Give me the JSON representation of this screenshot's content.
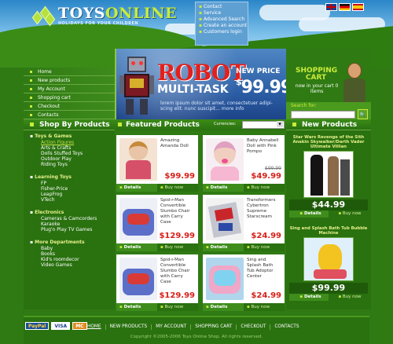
{
  "header": {
    "logo_main": "TOYS",
    "logo_accent": "ONLINE",
    "tagline": "HOLIDAYS FOR YOUR CHILDREN",
    "top_links": [
      "Contact",
      "Service",
      "Advanced Search",
      "Create an account",
      "Customers login"
    ],
    "flags": [
      "flag-uk",
      "flag-germany",
      "flag-spain"
    ]
  },
  "leftnav": [
    "Home",
    "New products",
    "My Account",
    "Shopping cart",
    "Checkout",
    "Contacts"
  ],
  "banner": {
    "headline": "ROBOT",
    "subheadline": "MULTI-TASK",
    "price_label": "NEW PRICE",
    "price_currency": "$",
    "price_value": "99.99",
    "description": "lorem ipsum dolor sit amet, consectetuer adipi-scing elit. nunc suscipit... more info"
  },
  "cart": {
    "title_line1": "SHOPPING",
    "title_line2": "CART",
    "info": "now in your cart 0 items"
  },
  "search": {
    "label": "Search for:",
    "placeholder": "",
    "button": "🔍"
  },
  "shop_by_products": {
    "title": "Shop By Products",
    "groups": [
      {
        "title": "Toys & Games",
        "links": [
          "Action Figures",
          "Arts & Crafts",
          "Dolls Stuffed Toys",
          "Outdoor Play",
          "Riding Toys"
        ],
        "active_index": 0
      },
      {
        "title": "Learning Toys",
        "links": [
          "FP",
          "Fisher-Price",
          "LeapFrog",
          "VTech"
        ],
        "active_index": -1
      },
      {
        "title": "Electronics",
        "links": [
          "Cameras & Camcorders",
          "Karaoke",
          "Plug'n Play TV Games"
        ],
        "active_index": -1
      },
      {
        "title": "More Departments",
        "links": [
          "Baby",
          "Books",
          "Kid's roomdecor",
          "Video Games"
        ],
        "active_index": -1
      }
    ]
  },
  "featured": {
    "title": "Featured Products",
    "currencies_label": "Currencies:",
    "currency_selected": "",
    "details_label": "Details",
    "buy_label": "Buy now",
    "products": [
      {
        "name": "Amazing Amanda Doll",
        "price": "$99.99",
        "old_price": "",
        "img_color": "#e9c4a6"
      },
      {
        "name": "Baby Annabell Doll with Pink Pompo",
        "price": "$49.99",
        "old_price": "$99.99",
        "img_color": "#e9cbd8"
      },
      {
        "name": "Spid-r-Man Convertible Slumbo Chair with Carry Case",
        "price": "$129.99",
        "old_price": "",
        "img_color": "#5b6fc9"
      },
      {
        "name": "Transformers Cybertron Supreme Starscream",
        "price": "$24.99",
        "old_price": "",
        "img_color": "#c4c6cf"
      },
      {
        "name": "Spid-r-Man Convertible Slumbo Chair with Carry Case",
        "price": "$129.99",
        "old_price": "",
        "img_color": "#5b6fc9"
      },
      {
        "name": "Sing and Splash Bath Tub Adoptor Center",
        "price": "$24.99",
        "old_price": "",
        "img_color": "#b0d6ee"
      }
    ]
  },
  "new_products": {
    "title": "New Products",
    "details_label": "Details",
    "buy_label": "Buy now",
    "items": [
      {
        "title": "Star Wars Revenge of the Sith Anakin Skywalker/Darth Vader Ultimate Villian",
        "price": "$44.99"
      },
      {
        "title": "Sing and Splash Bath Tub Bubble Machine",
        "price": "$99.99"
      }
    ]
  },
  "footer": {
    "payments": [
      "PayPal",
      "VISA",
      "MC"
    ],
    "nav": [
      "HOME",
      "NEW PRODUCTS",
      "MY ACCOUNT",
      "SHOPPING CART",
      "CHECKOUT",
      "CONTACTS"
    ],
    "copyright": "Copyright ©2005-2006 Toys Online Shop. All rights reserved."
  },
  "colors": {
    "green_dark": "#2a7110",
    "green_light": "#c8ec3b",
    "price_red": "#d7211a",
    "banner_blue": "#2d5fa6"
  }
}
